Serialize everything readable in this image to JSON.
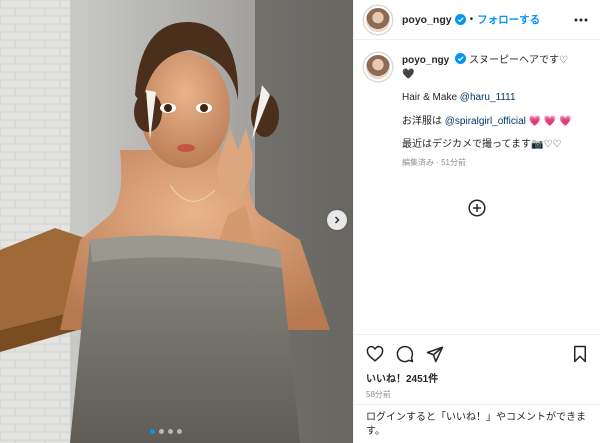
{
  "post": {
    "username": "poyo_ngy",
    "follow_label": "フォローする",
    "separator": "•"
  },
  "caption": {
    "username": "poyo_ngy",
    "line1": "スヌーピーヘアです♡",
    "line1_end": "🖤",
    "line2": "Hair & Make ",
    "line2_mention": "@haru_1111",
    "line3": "お洋服は ",
    "line3_mention": "@spiralgirl_official",
    "line3_hearts": " 💗 💗 💗",
    "line4": "最近はデジカメで撮ってます📷♡♡",
    "meta": "編集済み · 51分前"
  },
  "engagement": {
    "likes": "いいね！2451件",
    "date": "58分前"
  },
  "login_prompt": "ログインすると「いいね！」やコメントができます。",
  "carousel": {
    "total_slides": 4,
    "active_index": 0
  },
  "icons": {
    "verified": "verified-badge-icon",
    "more": "more-options-icon",
    "add_comment": "plus-circle-icon",
    "like": "heart-icon",
    "comment": "comment-icon",
    "share": "share-icon",
    "save": "bookmark-icon",
    "next": "chevron-right-icon"
  },
  "colors": {
    "accent": "#0095f6",
    "text": "#262626",
    "muted": "#8e8e8e",
    "mention": "#00376b"
  }
}
